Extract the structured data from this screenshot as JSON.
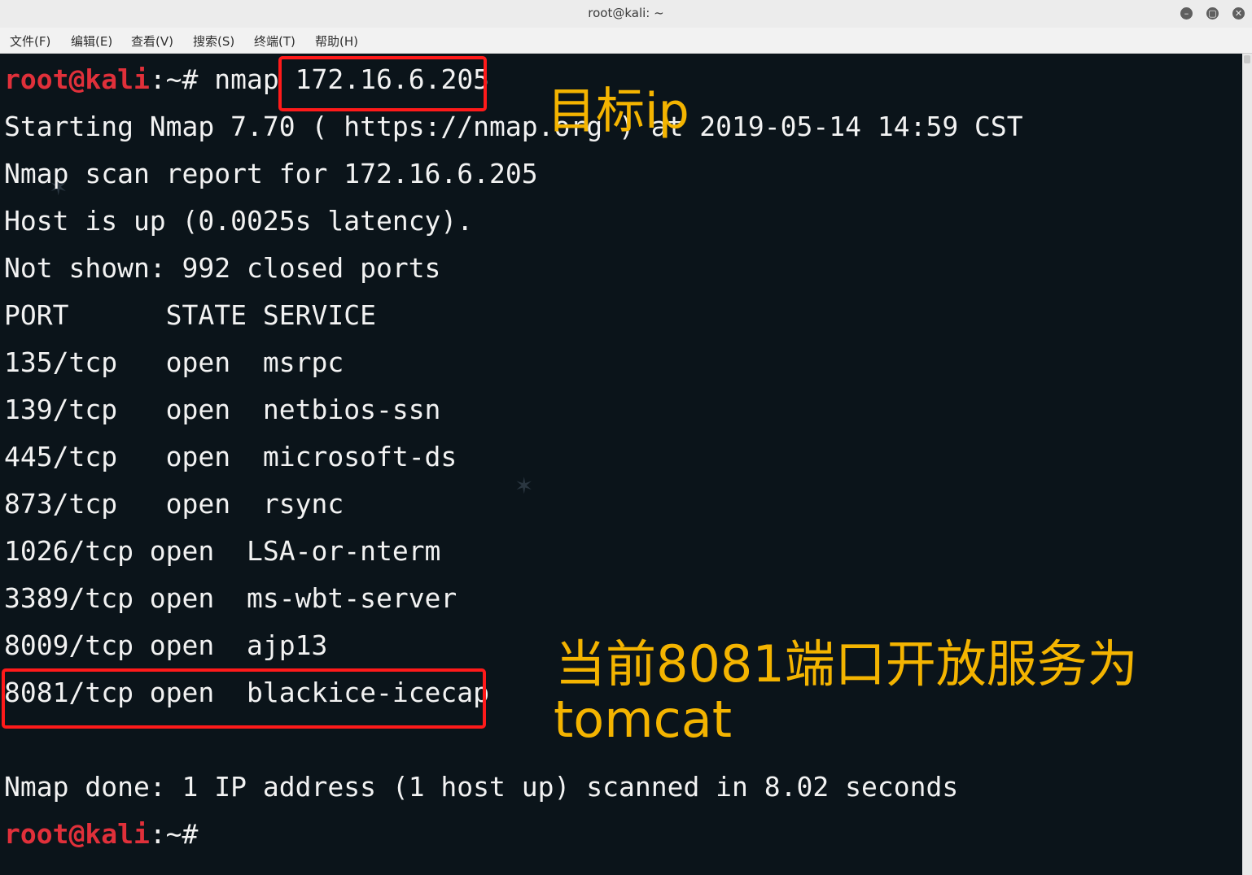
{
  "window": {
    "title": "root@kali: ~",
    "controls": {
      "minimize": "–",
      "maximize": "▢",
      "close": "✕"
    }
  },
  "menu": [
    "文件(F)",
    "编辑(E)",
    "查看(V)",
    "搜索(S)",
    "终端(T)",
    "帮助(H)"
  ],
  "terminal": {
    "prompt_user": "root@kali",
    "prompt_rest": ":~#",
    "command": " nmap ",
    "target_ip": "172.16.6.205",
    "lines": [
      "Starting Nmap 7.70 ( https://nmap.org ) at 2019-05-14 14:59 CST",
      "Nmap scan report for 172.16.6.205",
      "Host is up (0.0025s latency).",
      "Not shown: 992 closed ports",
      "PORT      STATE SERVICE",
      "135/tcp   open  msrpc",
      "139/tcp   open  netbios-ssn",
      "445/tcp   open  microsoft-ds",
      "873/tcp   open  rsync",
      "1026/tcp open  LSA-or-nterm",
      "3389/tcp open  ms-wbt-server",
      "8009/tcp open  ajp13",
      "8081/tcp open  blackice-icecap"
    ],
    "done_line": "Nmap done: 1 IP address (1 host up) scanned in 8.02 seconds"
  },
  "annotations": {
    "target_ip_label": "目标ip",
    "note_line1": "当前8081端口开放服务为",
    "note_line2": "tomcat",
    "color": "#f4b400",
    "highlight_color": "#ff1a1a"
  }
}
